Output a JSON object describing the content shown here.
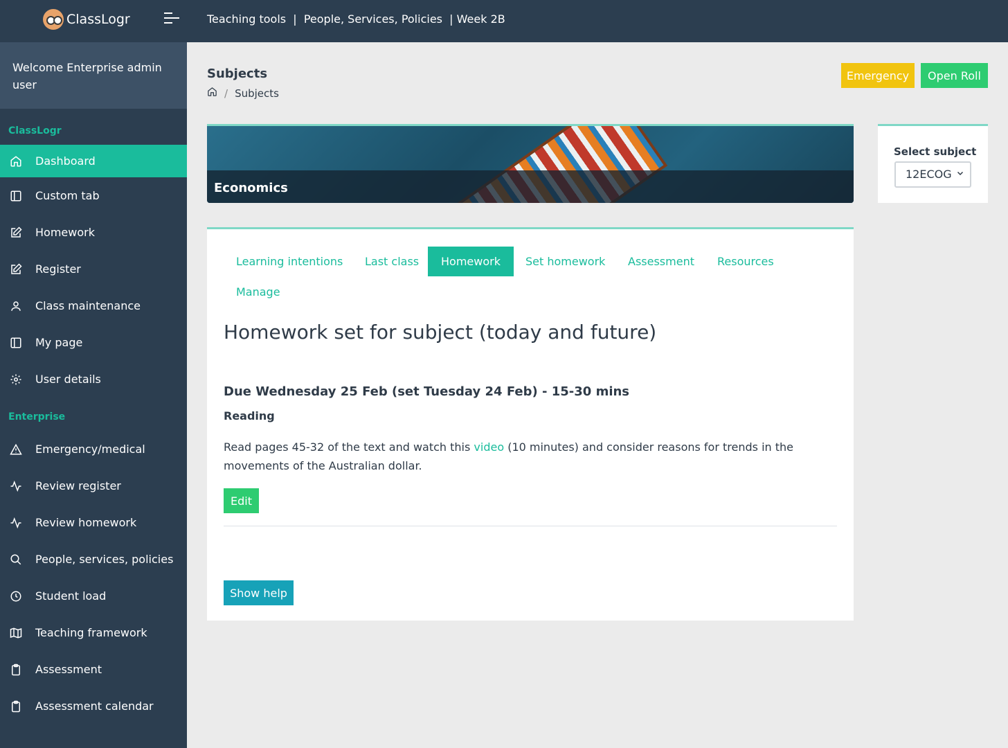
{
  "app": {
    "name": "ClassLogr"
  },
  "topnav": {
    "item1": "Teaching tools",
    "sep1": "  |  ",
    "item2": "People, Services, Policies",
    "sep2": "  | ",
    "item3": "Week 2B"
  },
  "sidebar": {
    "welcome": "Welcome Enterprise admin user",
    "section1": "ClassLogr",
    "section2": "Enterprise",
    "items1": [
      {
        "label": "Dashboard",
        "icon": "home-icon"
      },
      {
        "label": "Custom tab",
        "icon": "panel-icon"
      },
      {
        "label": "Homework",
        "icon": "edit-icon"
      },
      {
        "label": "Register",
        "icon": "edit-icon"
      },
      {
        "label": "Class maintenance",
        "icon": "user-icon"
      },
      {
        "label": "My page",
        "icon": "panel-icon"
      },
      {
        "label": "User details",
        "icon": "gear-icon"
      }
    ],
    "items2": [
      {
        "label": "Emergency/medical",
        "icon": "warning-icon"
      },
      {
        "label": "Review register",
        "icon": "activity-icon"
      },
      {
        "label": "Review homework",
        "icon": "activity-icon"
      },
      {
        "label": "People, services, policies",
        "icon": "search-icon"
      },
      {
        "label": "Student load",
        "icon": "clock-icon"
      },
      {
        "label": "Teaching framework",
        "icon": "map-icon"
      },
      {
        "label": "Assessment",
        "icon": "clipboard-icon"
      },
      {
        "label": "Assessment calendar",
        "icon": "clipboard-icon"
      }
    ]
  },
  "page": {
    "title": "Subjects",
    "breadcrumb": "Subjects",
    "emergency_label": "Emergency",
    "openroll_label": "Open Roll"
  },
  "banner": {
    "label": "Economics"
  },
  "subject_select": {
    "label": "Select subject",
    "value": "12ECOG"
  },
  "tabs": [
    "Learning intentions",
    "Last class",
    "Homework",
    "Set homework",
    "Assessment",
    "Resources",
    "Manage"
  ],
  "homework": {
    "heading": "Homework set for subject (today and future)",
    "due": "Due Wednesday 25 Feb (set Tuesday 24 Feb) - 15-30 mins",
    "type": "Reading",
    "desc_before": "Read pages 45-32 of the text and watch this ",
    "desc_link": "video",
    "desc_after": " (10 minutes) and consider reasons for trends in the movements of the Australian dollar.",
    "edit_label": "Edit",
    "help_label": "Show help"
  },
  "colors": {
    "accent": "#1abc9c",
    "sidebar": "#2c3e50",
    "warning": "#f1c40f",
    "success": "#2ecc71",
    "info": "#17a2b8"
  }
}
